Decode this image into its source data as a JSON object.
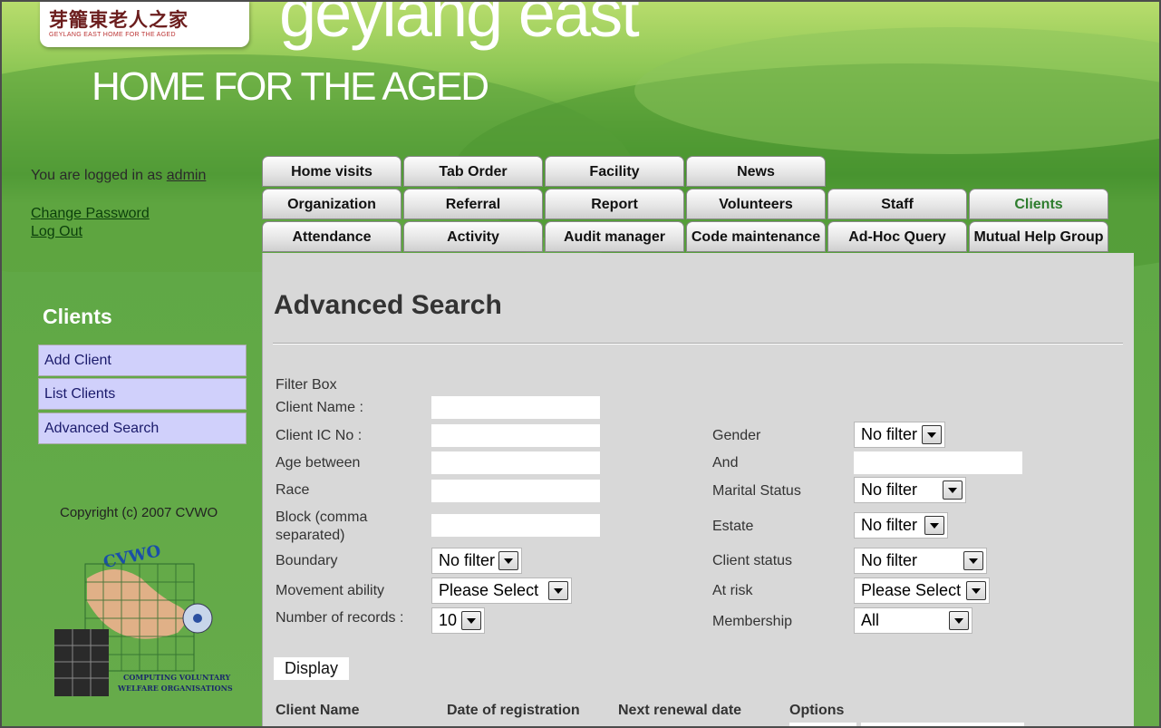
{
  "brand": {
    "logo_cn": "芽籠東老人之家",
    "logo_en": "GEYLANG EAST HOME FOR THE AGED",
    "title_line1": "geylang east",
    "title_line2": "HOME FOR THE AGED"
  },
  "session": {
    "logged_in_text": "You are logged in as",
    "username": "admin",
    "change_password": "Change Password",
    "log_out": "Log Out"
  },
  "sidebar": {
    "title": "Clients",
    "items": [
      {
        "label": "Add Client"
      },
      {
        "label": "List Clients"
      },
      {
        "label": "Advanced Search"
      }
    ],
    "copyright": "Copyright (c) 2007 CVWO",
    "cvwo_logo_text": "CVWO",
    "cvwo_caption1": "COMPUTING VOLUNTARY",
    "cvwo_caption2": "WELFARE ORGANISATIONS"
  },
  "tabs": {
    "row1": [
      "Home visits",
      "Tab Order",
      "Facility",
      "News"
    ],
    "row2": [
      "Organization",
      "Referral",
      "Report",
      "Volunteers",
      "Staff",
      "Clients"
    ],
    "row3": [
      "Attendance",
      "Activity",
      "Audit manager",
      "Code maintenance",
      "Ad-Hoc Query",
      "Mutual Help Group"
    ],
    "active": "Clients",
    "active_color": "#2e7d2e"
  },
  "search": {
    "title": "Advanced Search",
    "filter_box": "Filter Box",
    "labels": {
      "client_name": "Client Name :",
      "client_ic": "Client IC No :",
      "age_between": "Age between",
      "race": "Race",
      "block_line1": "Block (comma",
      "block_line2": "separated)",
      "boundary": "Boundary",
      "movement": "Movement ability",
      "records": "Number of records :",
      "gender": "Gender",
      "and": "And",
      "marital": "Marital Status",
      "estate": "Estate",
      "client_status": "Client status",
      "at_risk": "At risk",
      "membership": "Membership"
    },
    "values": {
      "client_name": "",
      "client_ic": "",
      "age_from": "",
      "age_to": "",
      "race": "",
      "block": ""
    },
    "selects": {
      "boundary": "No filter",
      "movement": "Please Select",
      "records": "10",
      "gender": "No filter",
      "marital": "No filter",
      "estate": "No filter",
      "client_status": "No filter",
      "at_risk": "Please Select",
      "membership": "All"
    },
    "display_button": "Display"
  },
  "results": {
    "columns": [
      "Client Name",
      "Date of registration",
      "Next renewal date",
      "Options"
    ]
  }
}
